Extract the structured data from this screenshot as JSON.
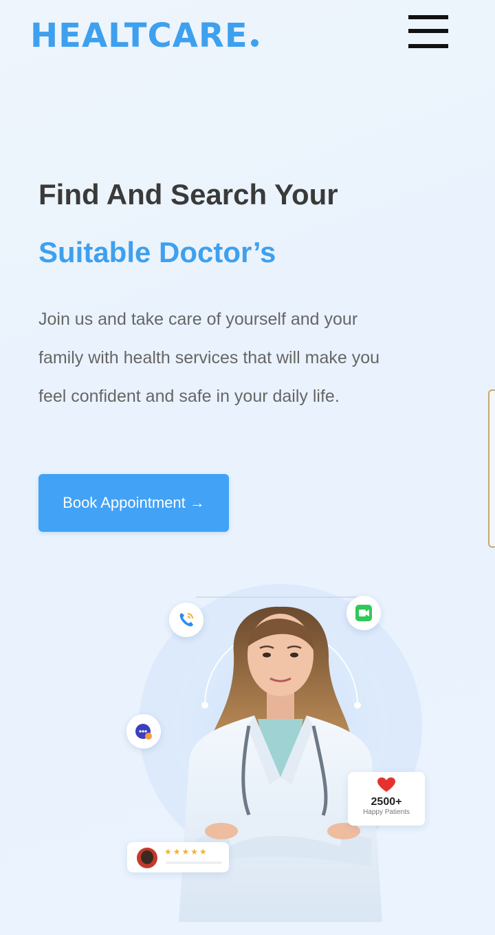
{
  "header": {
    "logo_text": "HEALTCARE"
  },
  "hero": {
    "title_line1": "Find And Search Your",
    "title_line2": "Suitable Doctor’s",
    "description": "Join us and take care of yourself and your family with health services that will make you feel confident and safe in your daily life.",
    "cta_label": "Book Appointment →"
  },
  "stats": {
    "patients_count": "2500+",
    "patients_label": "Happy Patients",
    "rating_stars": "★★★★★"
  },
  "colors": {
    "accent": "#3ea0ee",
    "button": "#42a2f5",
    "heading": "#3a3a3a",
    "text": "#666666"
  },
  "icons": {
    "menu": "hamburger-icon",
    "call": "phone-call-icon",
    "video": "video-call-icon",
    "chat": "chat-support-icon",
    "heart": "heart-icon"
  }
}
